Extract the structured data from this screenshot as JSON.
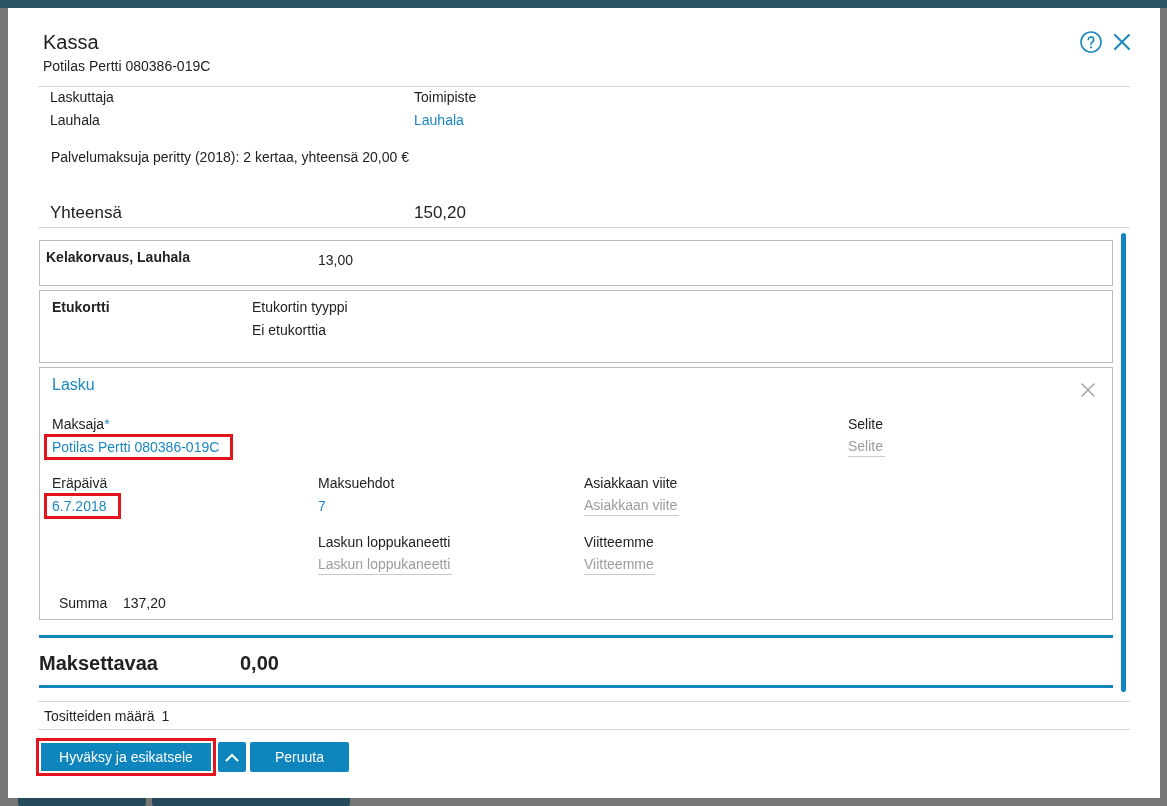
{
  "dialog": {
    "title": "Kassa",
    "subtitle": "Potilas Pertti 080386-019C"
  },
  "details": [
    {
      "label": "Laskuttaja",
      "value": "Lauhala",
      "kind": "text"
    },
    {
      "label": "Toimipiste",
      "value": "Lauhala",
      "kind": "link"
    }
  ],
  "service_fee_note": "Palvelumaksuja peritty (2018): 2 kertaa, yhteensä 20,00 €",
  "total": {
    "label": "Yhteensä",
    "value": "150,20"
  },
  "reimbursement": {
    "label": "Kelakorvaus, Lauhala",
    "value": "13,00"
  },
  "benefit_card": {
    "title": "Etukortti",
    "label": "Etukortin tyyppi",
    "value": "Ei etukorttia"
  },
  "invoice": {
    "title": "Lasku",
    "payer": {
      "label": "Maksaja",
      "required_mark": "*",
      "value": "Potilas Pertti 080386-019C",
      "kind": "link",
      "highlighted": true
    },
    "description": {
      "label": "Selite",
      "placeholder": "Selite",
      "kind": "input"
    },
    "due_date": {
      "label": "Eräpäivä",
      "value": "6.7.2018",
      "kind": "link",
      "highlighted": true
    },
    "payment_terms": {
      "label": "Maksuehdot",
      "value": "7",
      "kind": "link",
      "highlighted": false
    },
    "customer_reference": {
      "label": "Asiakkaan viite",
      "placeholder": "Asiakkaan viite",
      "kind": "input"
    },
    "closing_note": {
      "label": "Laskun loppukaneetti",
      "placeholder": "Laskun loppukaneetti",
      "kind": "input"
    },
    "our_reference": {
      "label": "Viitteemme",
      "placeholder": "Viitteemme",
      "kind": "input"
    },
    "sum": {
      "label": "Summa",
      "value": "137,20"
    }
  },
  "to_pay": {
    "label": "Maksettavaa",
    "value": "0,00"
  },
  "voucher_count": {
    "label": "Tositteiden määrä",
    "value": "1"
  },
  "buttons": [
    {
      "label": "Hyväksy ja esikatsele",
      "kind": "text",
      "highlighted": true
    },
    {
      "kind": "chevron",
      "highlighted": false
    },
    {
      "label": "Peruuta",
      "kind": "text",
      "highlighted": false
    }
  ]
}
